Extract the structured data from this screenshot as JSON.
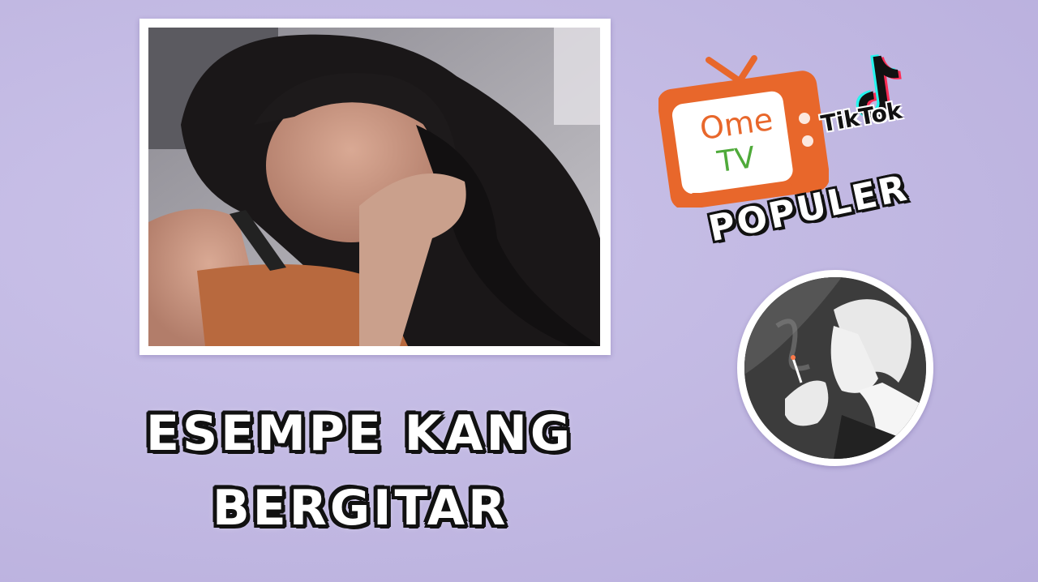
{
  "logos": {
    "ome": "Ome",
    "tv": "TV",
    "tiktok": "TikTok",
    "badge": "POPULER",
    "colors": {
      "ome_orange": "#e8672b",
      "ome_green": "#4faa3a",
      "tiktok_cyan": "#25f4ee",
      "tiktok_red": "#fe2c55"
    }
  },
  "title": {
    "line1": "ESEMPE KANG",
    "line2": "BERGITAR"
  },
  "icons": {
    "video": "video-thumbnail",
    "avatar": "channel-avatar-icon",
    "tv": "tv-icon",
    "tiktok": "tiktok-note-icon"
  },
  "background_color": "#c1b8e2"
}
